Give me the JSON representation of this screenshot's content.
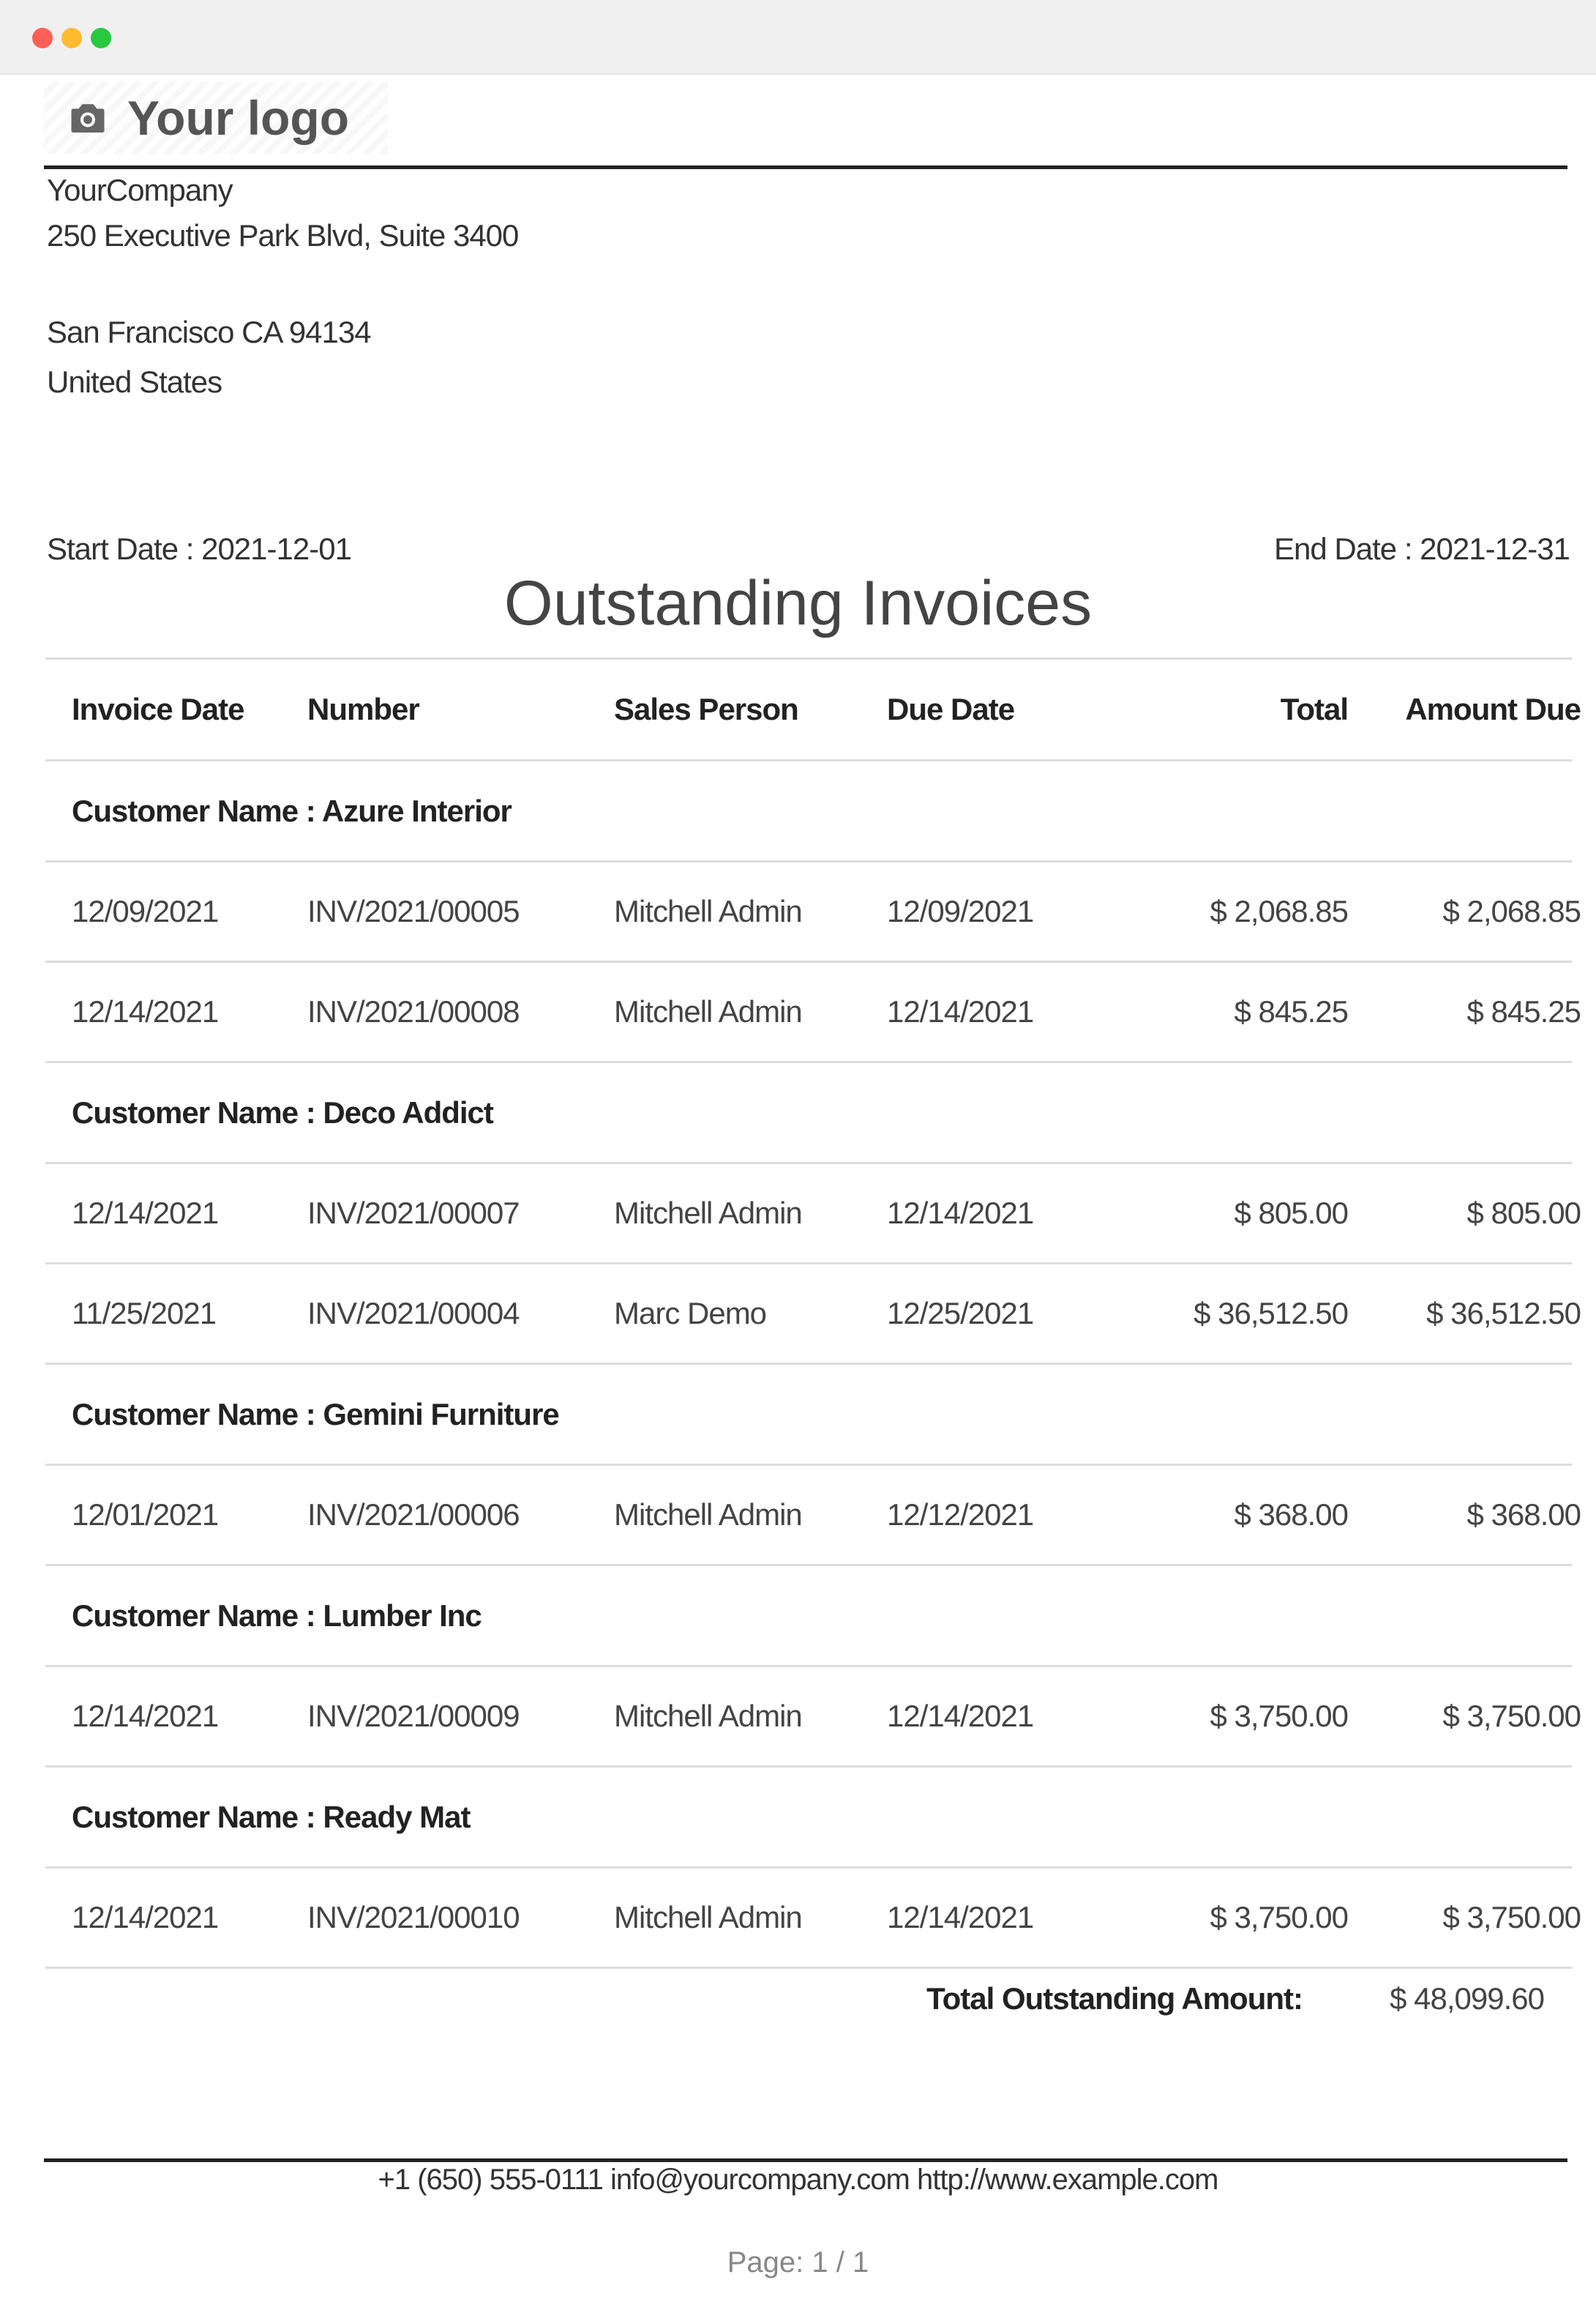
{
  "window": {
    "controls": [
      "close",
      "minimize",
      "maximize"
    ]
  },
  "logo": {
    "text": "Your logo",
    "icon": "camera-icon"
  },
  "company": {
    "name": "YourCompany",
    "street": "250 Executive Park Blvd, Suite 3400",
    "city": "San Francisco CA 94134",
    "country": "United States"
  },
  "report": {
    "start_date": "Start Date : 2021-12-01",
    "end_date": "End Date : 2021-12-31",
    "title": "Outstanding Invoices",
    "columns": [
      "Invoice Date",
      "Number",
      "Sales Person",
      "Due Date",
      "Total",
      "Amount Due"
    ],
    "groups": [
      {
        "customer": "Customer Name : Azure Interior",
        "rows": [
          [
            "12/09/2021",
            "INV/2021/00005",
            "Mitchell Admin",
            "12/09/2021",
            "$ 2,068.85",
            "$ 2,068.85"
          ],
          [
            "12/14/2021",
            "INV/2021/00008",
            "Mitchell Admin",
            "12/14/2021",
            "$ 845.25",
            "$ 845.25"
          ]
        ]
      },
      {
        "customer": "Customer Name : Deco Addict",
        "rows": [
          [
            "12/14/2021",
            "INV/2021/00007",
            "Mitchell Admin",
            "12/14/2021",
            "$ 805.00",
            "$ 805.00"
          ],
          [
            "11/25/2021",
            "INV/2021/00004",
            "Marc Demo",
            "12/25/2021",
            "$ 36,512.50",
            "$ 36,512.50"
          ]
        ]
      },
      {
        "customer": "Customer Name : Gemini Furniture",
        "rows": [
          [
            "12/01/2021",
            "INV/2021/00006",
            "Mitchell Admin",
            "12/12/2021",
            "$ 368.00",
            "$ 368.00"
          ]
        ]
      },
      {
        "customer": "Customer Name : Lumber Inc",
        "rows": [
          [
            "12/14/2021",
            "INV/2021/00009",
            "Mitchell Admin",
            "12/14/2021",
            "$ 3,750.00",
            "$ 3,750.00"
          ]
        ]
      },
      {
        "customer": "Customer Name : Ready Mat",
        "rows": [
          [
            "12/14/2021",
            "INV/2021/00010",
            "Mitchell Admin",
            "12/14/2021",
            "$ 3,750.00",
            "$ 3,750.00"
          ]
        ]
      }
    ],
    "total_label": "Total Outstanding Amount:",
    "total_value": "$ 48,099.60"
  },
  "footer": {
    "contact": "+1 (650) 555-0111 info@yourcompany.com http://www.example.com",
    "page": "Page: 1 / 1"
  }
}
